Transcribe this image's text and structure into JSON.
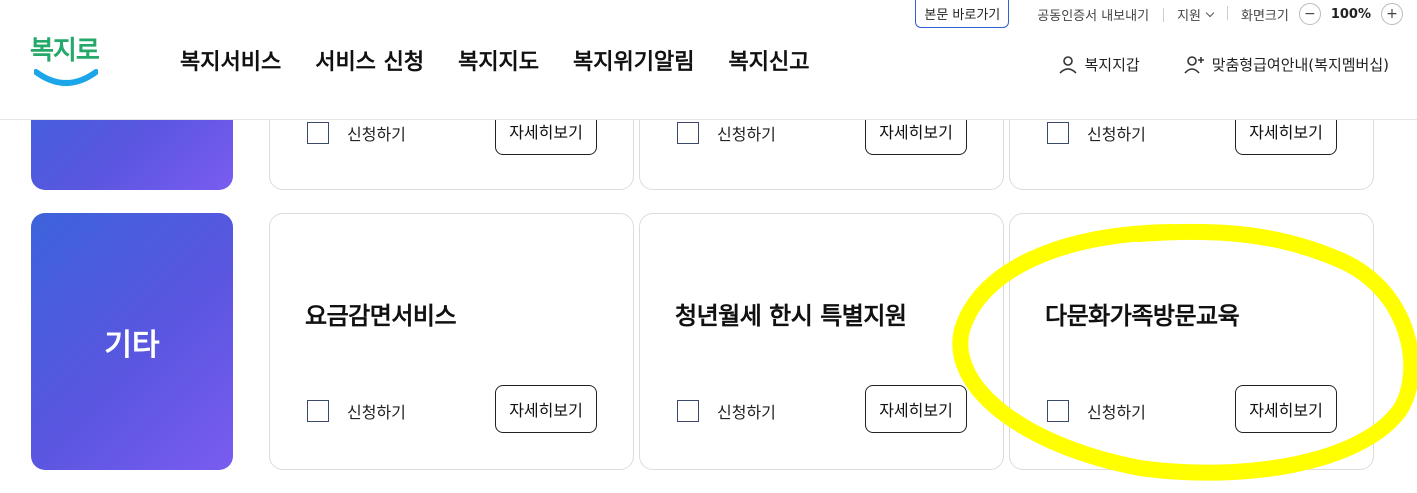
{
  "header": {
    "logo_text": "복지로",
    "utility": {
      "skip_link": "본문 바로가기",
      "cert_export": "공동인증서 내보내기",
      "support": "지원",
      "screen_size_label": "화면크기",
      "zoom_minus": "−",
      "zoom_value": "100%",
      "zoom_plus": "+"
    },
    "nav": [
      "복지서비스",
      "서비스 신청",
      "복지지도",
      "복지위기알림",
      "복지신고"
    ],
    "wallet": "복지지갑",
    "membership": "맞춤형급여안내(복지멤버십)"
  },
  "top_row": {
    "cards": [
      {
        "apply_label": "신청하기",
        "detail_label": "자세히보기"
      },
      {
        "apply_label": "신청하기",
        "detail_label": "자세히보기"
      },
      {
        "apply_label": "신청하기",
        "detail_label": "자세히보기"
      }
    ]
  },
  "bottom_row": {
    "category": "기타",
    "cards": [
      {
        "title": "요금감면서비스",
        "apply_label": "신청하기",
        "detail_label": "자세히보기"
      },
      {
        "title": "청년월세 한시 특별지원",
        "apply_label": "신청하기",
        "detail_label": "자세히보기"
      },
      {
        "title": "다문화가족방문교육",
        "apply_label": "신청하기",
        "detail_label": "자세히보기"
      }
    ]
  },
  "colors": {
    "category_gradient_start": "#3d63db",
    "category_gradient_end": "#7a5cf0",
    "highlight": "#ffff00",
    "logo_green": "#25a96a",
    "logo_blue": "#1aa6e8"
  }
}
